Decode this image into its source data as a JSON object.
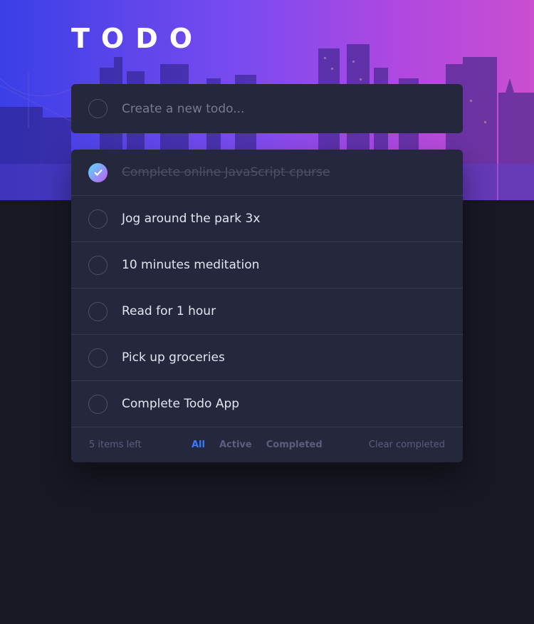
{
  "header": {
    "title": "TODO"
  },
  "new_todo": {
    "placeholder": "Create a new todo..."
  },
  "todos": [
    {
      "text": "Complete online JavaScript cpurse",
      "completed": true
    },
    {
      "text": "Jog around the park 3x",
      "completed": false
    },
    {
      "text": "10 minutes meditation",
      "completed": false
    },
    {
      "text": "Read for 1 hour",
      "completed": false
    },
    {
      "text": "Pick up groceries",
      "completed": false
    },
    {
      "text": "Complete Todo App",
      "completed": false
    }
  ],
  "footer": {
    "items_left": "5 items left",
    "filters": [
      {
        "label": "All",
        "active": true
      },
      {
        "label": "Active",
        "active": false
      },
      {
        "label": "Completed",
        "active": false
      }
    ],
    "clear_label": "Clear completed"
  },
  "colors": {
    "accent": "#3a7bfd",
    "card": "#25273c",
    "background": "#181824",
    "check_gradient_start": "#57ddff",
    "check_gradient_end": "#c058f3"
  }
}
